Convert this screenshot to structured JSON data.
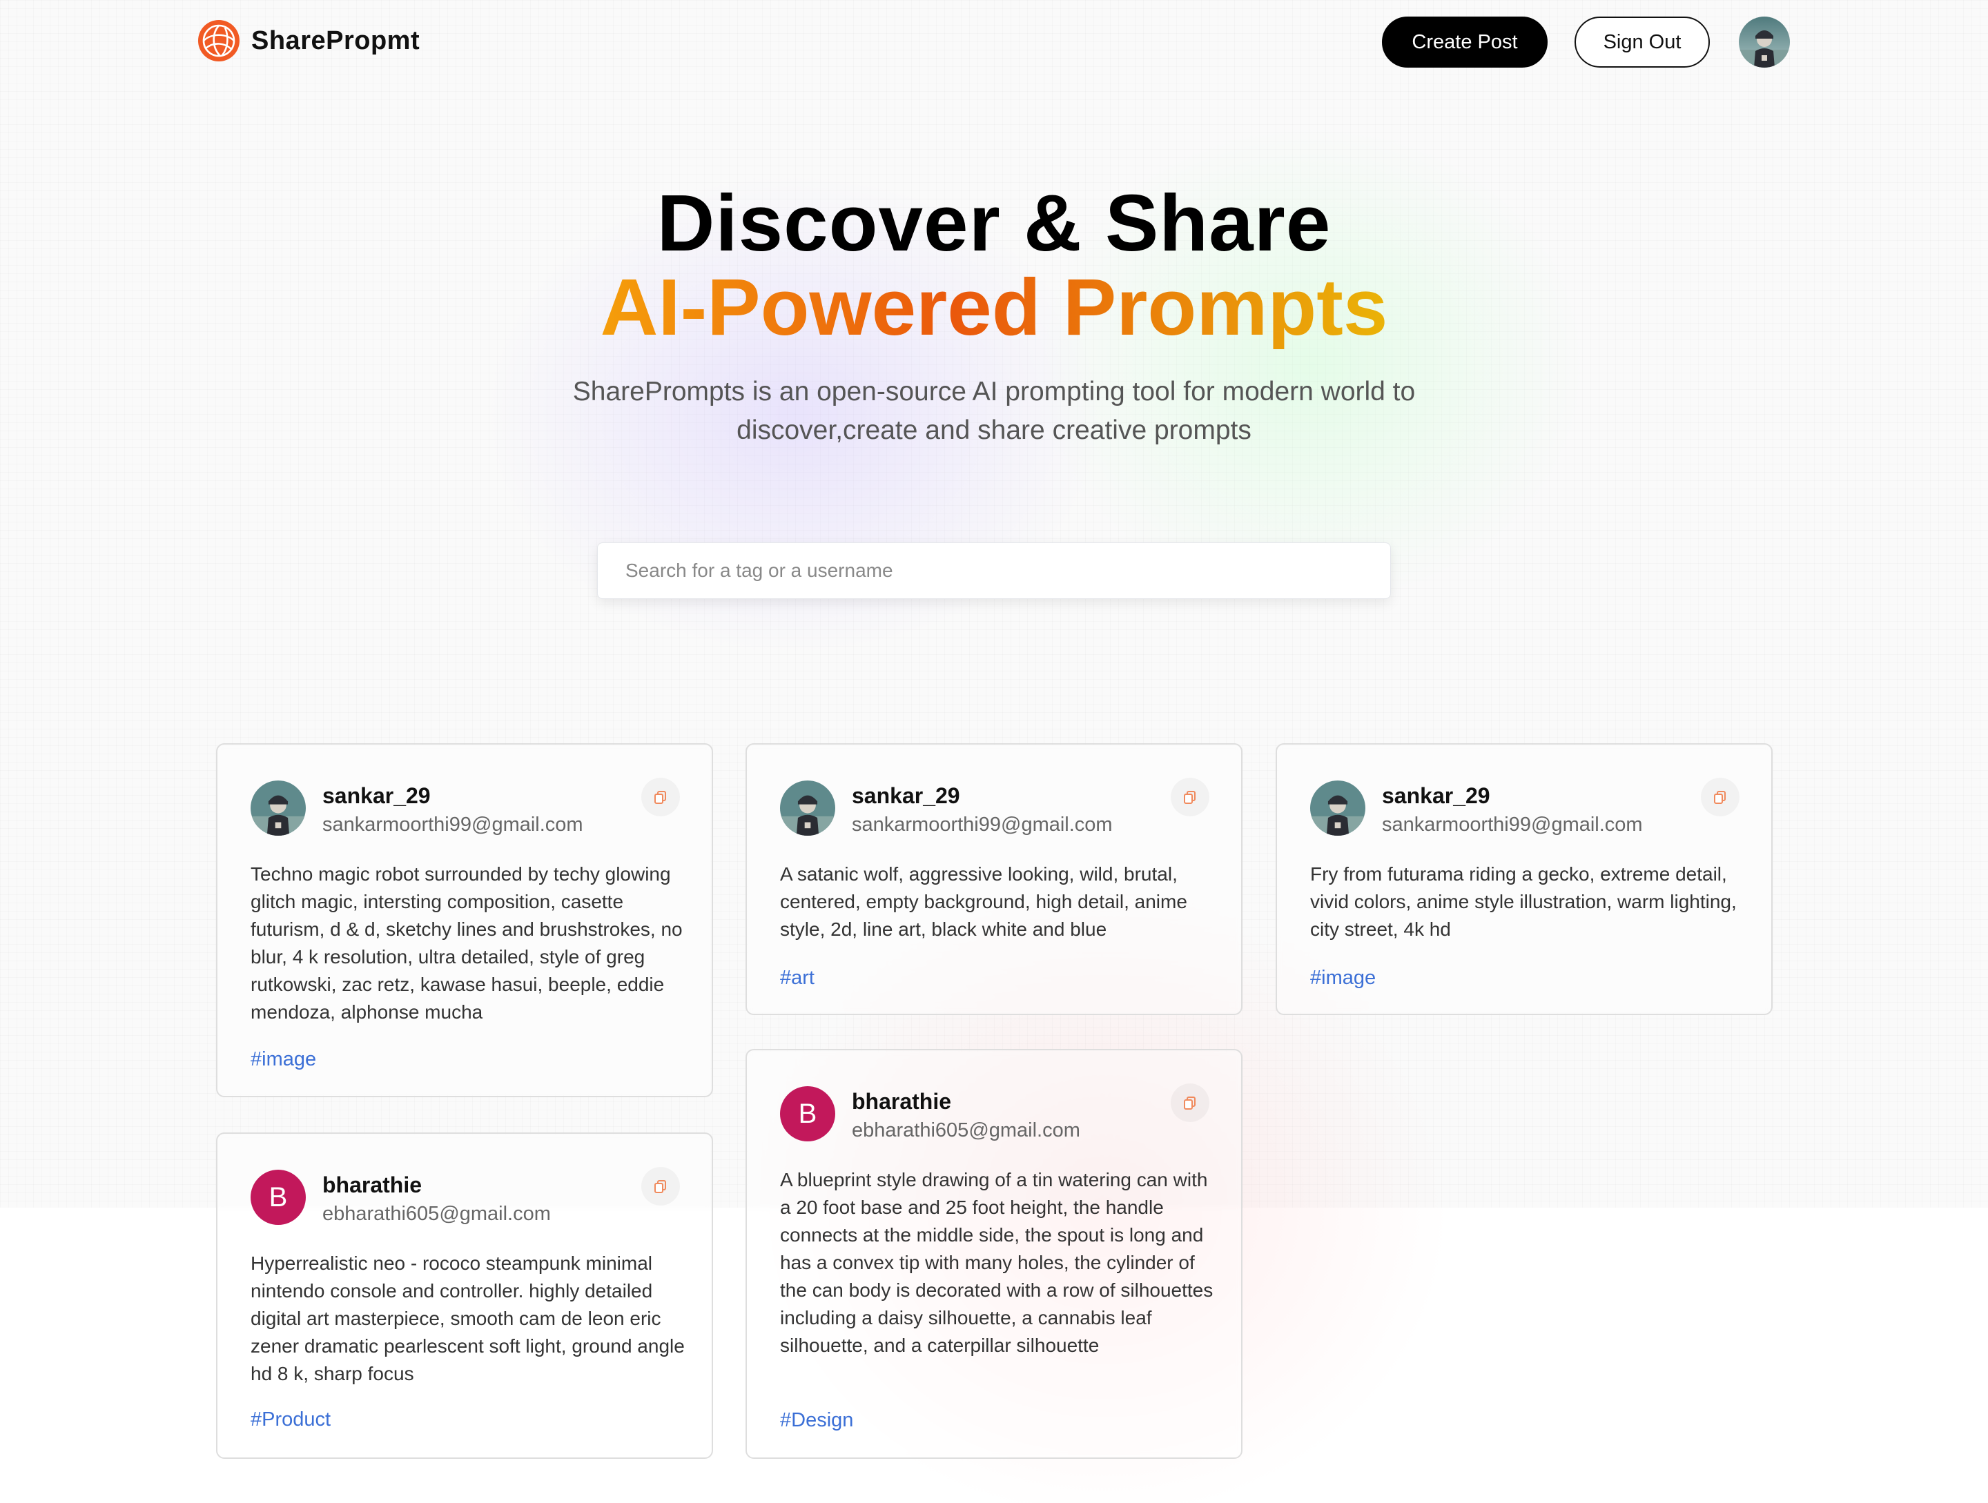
{
  "brand": {
    "name": "SharePropmt",
    "logo_icon": "globe-icon",
    "accent": "#f15a24"
  },
  "nav": {
    "create_label": "Create Post",
    "signout_label": "Sign Out"
  },
  "hero": {
    "title": "Discover & Share",
    "highlight": "AI-Powered Prompts",
    "description": "SharePrompts is an open-source AI prompting tool for modern world to discover,create and share creative prompts"
  },
  "search": {
    "placeholder": "Search for a tag or a username",
    "value": ""
  },
  "colors": {
    "tag": "#3b6fd6",
    "gradient": [
      "#f59e0b",
      "#ea580c",
      "#eab308"
    ],
    "b_avatar": "#c2185b"
  },
  "posts": [
    {
      "username": "sankar_29",
      "email": "sankarmoorthi99@gmail.com",
      "prompt": "Techno magic robot surrounded by techy glowing glitch magic, intersting composition, casette futurism, d & d, sketchy lines and brushstrokes, no blur, 4 k resolution, ultra detailed, style of greg rutkowski, zac retz, kawase hasui, beeple, eddie mendoza, alphonse mucha",
      "tag": "#image"
    },
    {
      "username": "sankar_29",
      "email": "sankarmoorthi99@gmail.com",
      "prompt": "A satanic wolf, aggressive looking, wild, brutal, centered, empty background, high detail, anime style, 2d, line art, black white and blue",
      "tag": "#art"
    },
    {
      "username": "sankar_29",
      "email": "sankarmoorthi99@gmail.com",
      "prompt": "Fry from futurama riding a gecko, extreme detail, vivid colors, anime style illustration, warm lighting, city street, 4k hd",
      "tag": "#image"
    },
    {
      "username": "bharathie",
      "email": "ebharathi605@gmail.com",
      "avatar_letter": "B",
      "prompt": "Hyperrealistic neo - rococo steampunk minimal nintendo console and controller. highly detailed digital art masterpiece, smooth cam de leon eric zener dramatic pearlescent soft light, ground angle hd 8 k, sharp focus",
      "tag": "#Product"
    },
    {
      "username": "bharathie",
      "email": "ebharathi605@gmail.com",
      "avatar_letter": "B",
      "prompt": "A blueprint style drawing of a tin watering can with a 20 foot base and 25 foot height, the handle connects at the middle side, the spout is long and has a convex tip with many holes, the cylinder of the can body is decorated with a row of silhouettes including a daisy silhouette, a cannabis leaf silhouette, and a caterpillar silhouette",
      "tag": "#Design"
    }
  ]
}
